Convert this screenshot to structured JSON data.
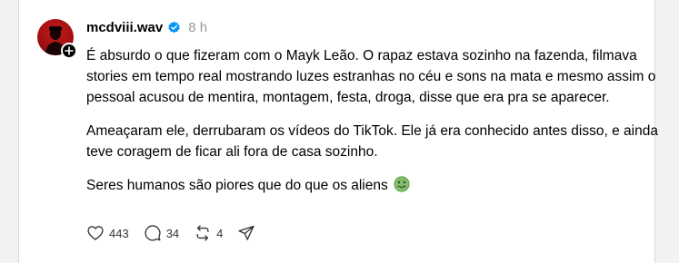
{
  "post": {
    "username": "mcdviii.wav",
    "time": "8 h",
    "more_label": "···",
    "paragraphs": [
      "É absurdo o que fizeram com o Mayk Leão. O rapaz estava sozinho na fazenda, filmava stories em tempo real mostrando luzes estranhas no céu e sons na mata e mesmo assim o pessoal acusou de mentira, montagem, festa, droga, disse que era pra se aparecer.",
      "Ameaçaram ele, derrubaram os vídeos do TikTok. Ele já era conhecido antes disso, e ainda teve coragem de ficar ali fora de casa sozinho.",
      "Seres humanos são piores que do que os aliens"
    ],
    "emoji": "nauseated-face-icon",
    "actions": {
      "likes": "443",
      "comments": "34",
      "reposts": "4"
    }
  },
  "colors": {
    "verified": "#0095f6",
    "muted_text": "#999999",
    "avatar_red": "#a10f10"
  }
}
